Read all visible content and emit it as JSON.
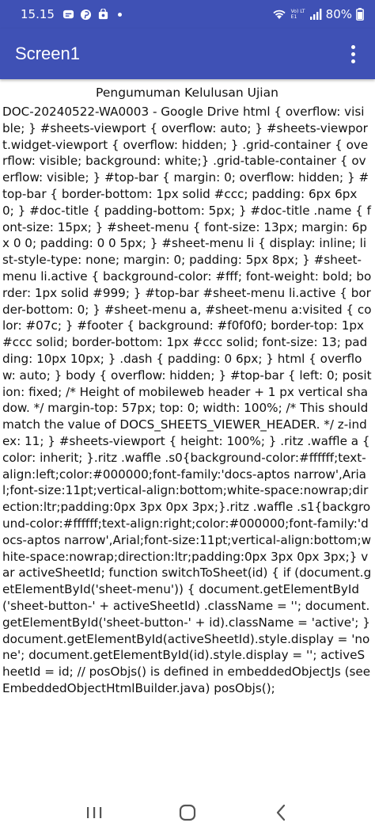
{
  "status_bar": {
    "time": "15.15",
    "network_label": "Vo) LTE1",
    "battery": "80%"
  },
  "app_bar": {
    "title": "Screen1"
  },
  "content": {
    "heading": "Pengumuman Kelulusan Ujian",
    "text": "DOC-20240522-WA0003 - Google Drive html { overflow: visible; } #sheets-viewport { overflow: auto; } #sheets-viewport.widget-viewport { overflow: hidden; } .grid-container { overflow: visible; background: white;} .grid-table-container { overflow: visible; } #top-bar { margin: 0; overflow: hidden; } #top-bar { border-bottom: 1px solid #ccc; padding: 6px 6px 0; } #doc-title { padding-bottom: 5px; } #doc-title .name { font-size: 15px; } #sheet-menu { font-size: 13px; margin: 6px 0 0; padding: 0 0 5px; } #sheet-menu li { display: inline; list-style-type: none; margin: 0; padding: 5px 8px; } #sheet-menu li.active { background-color: #fff; font-weight: bold; border: 1px solid #999; } #top-bar #sheet-menu li.active { border-bottom: 0; } #sheet-menu a, #sheet-menu a:visited { color: #07c; } #footer { background: #f0f0f0; border-top: 1px #ccc solid; border-bottom: 1px #ccc solid; font-size: 13; padding: 10px 10px; } .dash { padding: 0 6px; } html { overflow: auto; } body { overflow: hidden; } #top-bar { left: 0; position: fixed; /* Height of mobileweb header + 1 px vertical shadow. */ margin-top: 57px; top: 0; width: 100%; /* This should match the value of DOCS_SHEETS_VIEWER_HEADER. */ z-index: 11; } #sheets-viewport { height: 100%; } .ritz .waffle a { color: inherit; }.ritz .waffle .s0{background-color:#ffffff;text-align:left;color:#000000;font-family:'docs-aptos narrow',Arial;font-size:11pt;vertical-align:bottom;white-space:nowrap;direction:ltr;padding:0px 3px 0px 3px;}.ritz .waffle .s1{background-color:#ffffff;text-align:right;color:#000000;font-family:'docs-aptos narrow',Arial;font-size:11pt;vertical-align:bottom;white-space:nowrap;direction:ltr;padding:0px 3px 0px 3px;} var activeSheetId; function switchToSheet(id) { if (document.getElementById('sheet-menu')) { document.getElementById('sheet-button-' + activeSheetId) .className = ''; document.getElementById('sheet-button-' + id).className = 'active'; } document.getElementById(activeSheetId).style.display = 'none'; document.getElementById(id).style.display = ''; activeSheetId = id; // posObjs() is defined in embeddedObjectJs (see EmbeddedObjectHtmlBuilder.java) posObjs();"
  },
  "colors": {
    "primary": "#3f51b5",
    "on_primary": "#ffffff",
    "text": "#111111",
    "nav_icon": "#555555"
  },
  "icons": {
    "status_left": [
      "messages-icon",
      "pinterest-icon",
      "store-icon",
      "dot-icon"
    ],
    "status_right": [
      "wifi-icon",
      "signal-icon",
      "battery-icon"
    ],
    "app_bar": "more-vert-icon",
    "nav": [
      "recent-apps-icon",
      "home-icon",
      "back-icon"
    ]
  }
}
